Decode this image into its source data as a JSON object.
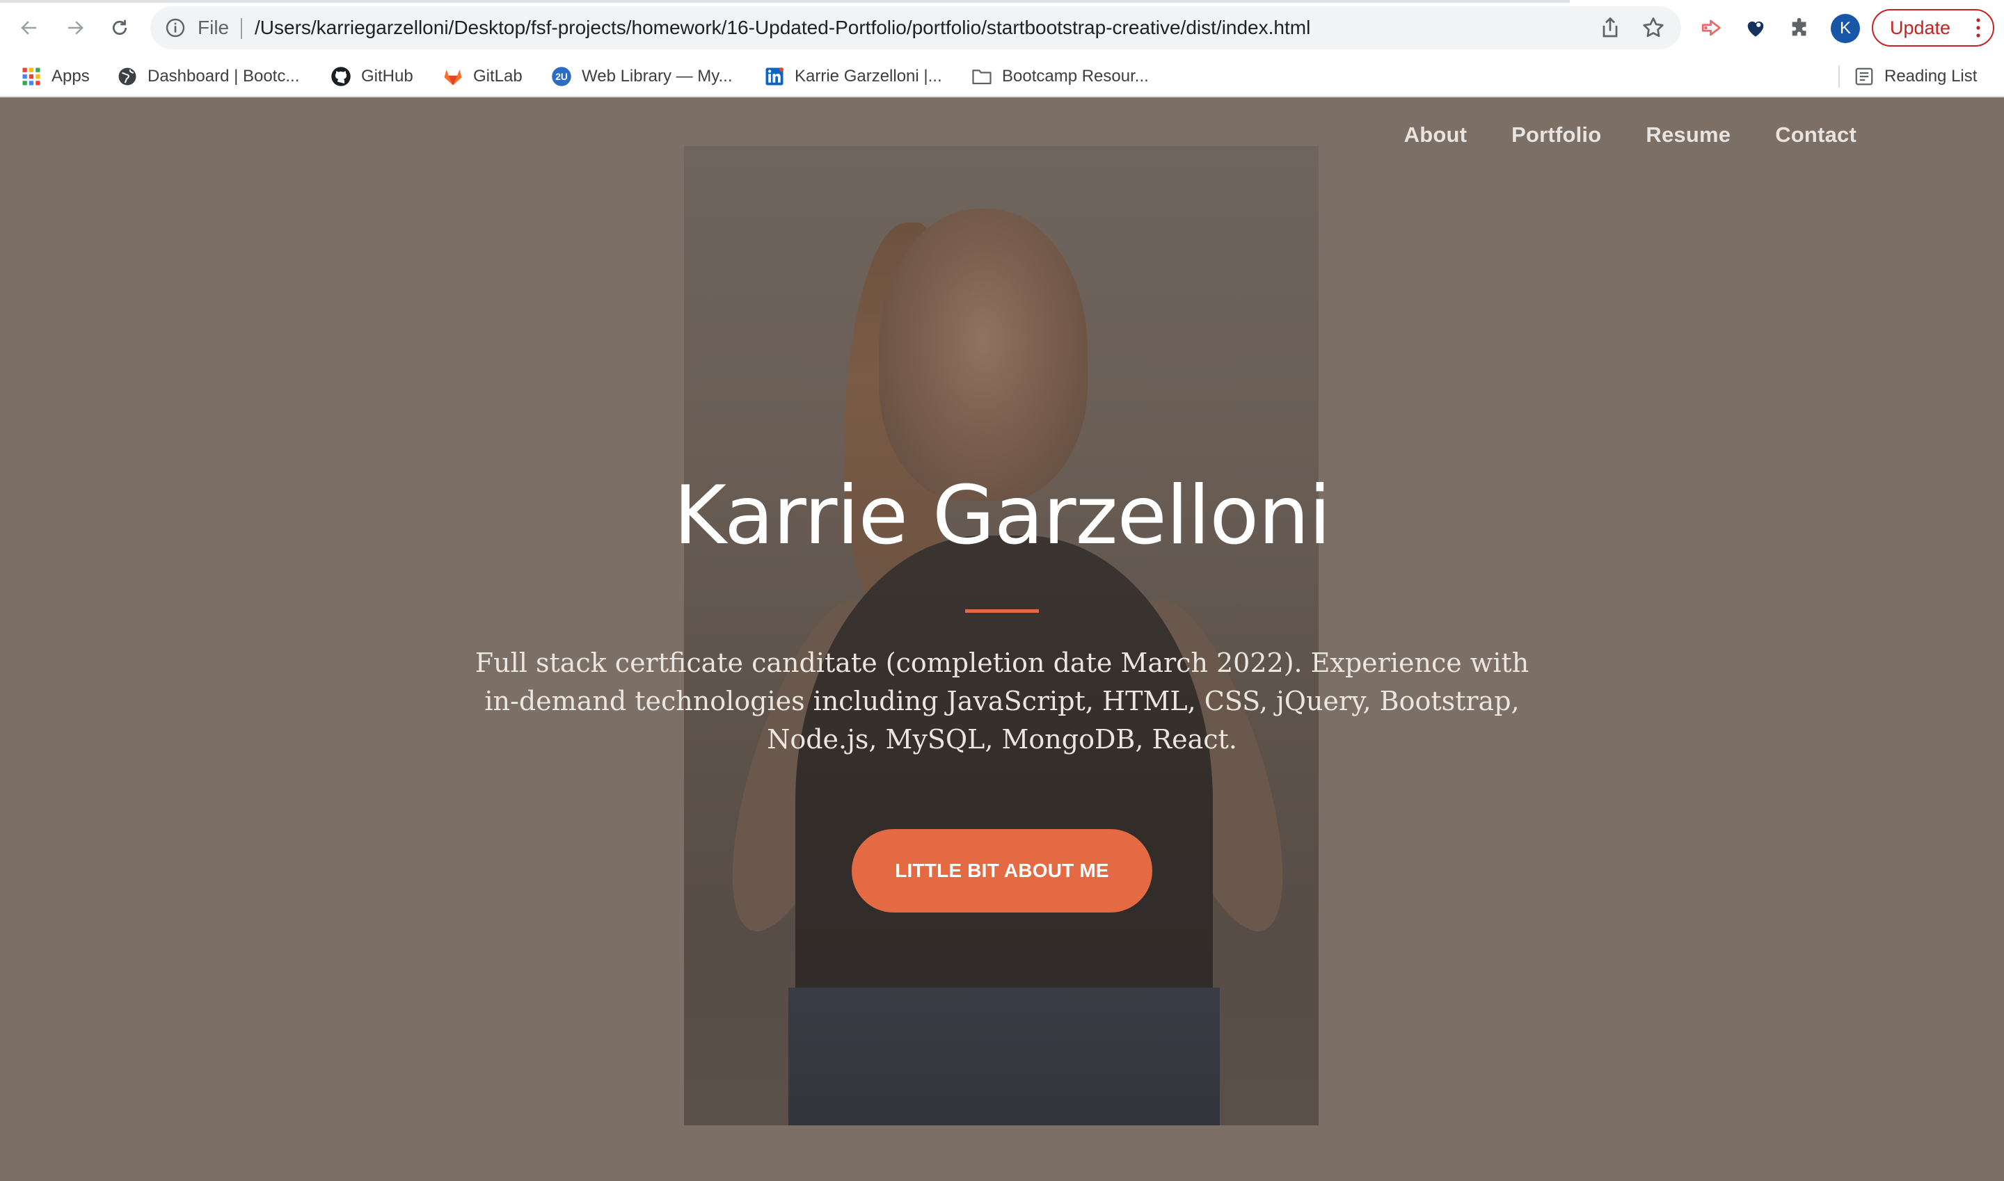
{
  "browser": {
    "url_scheme_label": "File",
    "url": "/Users/karriegarzelloni/Desktop/fsf-projects/homework/16-Updated-Portfolio/portfolio/startbootstrap-creative/dist/index.html",
    "profile_initial": "K",
    "update_label": "Update"
  },
  "bookmarks": [
    {
      "label": "Apps",
      "icon": "apps-grid-icon"
    },
    {
      "label": "Dashboard | Bootc...",
      "icon": "globe-icon"
    },
    {
      "label": "GitHub",
      "icon": "github-icon"
    },
    {
      "label": "GitLab",
      "icon": "gitlab-icon"
    },
    {
      "label": "Web Library — My...",
      "icon": "2u-icon"
    },
    {
      "label": "Karrie Garzelloni |...",
      "icon": "linkedin-icon"
    },
    {
      "label": "Bootcamp Resour...",
      "icon": "folder-icon"
    }
  ],
  "reading_list_label": "Reading List",
  "site": {
    "nav": [
      "About",
      "Portfolio",
      "Resume",
      "Contact"
    ],
    "hero_title": "Karrie Garzelloni",
    "hero_subtitle": "Full stack certficate canditate (completion date March 2022). Experience with in-demand technologies including JavaScript, HTML, CSS, jQuery, Bootstrap, Node.js, MySQL, MongoDB, React.",
    "cta_label": "LITTLE BIT ABOUT ME"
  },
  "colors": {
    "accent": "#e46a44",
    "overlay": "#7b6f66",
    "update_red": "#c5221f"
  }
}
